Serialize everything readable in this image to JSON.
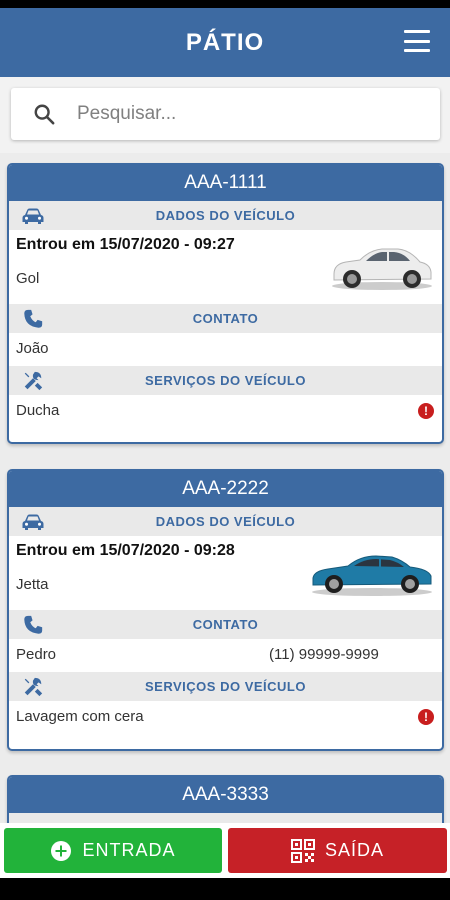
{
  "app": {
    "title": "PÁTIO"
  },
  "search": {
    "placeholder": "Pesquisar..."
  },
  "labels": {
    "vehicle_data": "DADOS DO VEÍCULO",
    "contact": "CONTATO",
    "services": "SERVIÇOS DO VEÍCULO"
  },
  "vehicles": [
    {
      "plate": "AAA-1111",
      "entry": "Entrou em 15/07/2020 - 09:27",
      "model": "Gol",
      "car_color": "#e9e9e9",
      "contact_name": "João",
      "phone": "",
      "service": "Ducha",
      "alert": "!"
    },
    {
      "plate": "AAA-2222",
      "entry": "Entrou em 15/07/2020 - 09:28",
      "model": "Jetta",
      "car_color": "#1f7ba6",
      "contact_name": "Pedro",
      "phone": "(11) 99999-9999",
      "service": "Lavagem com cera",
      "alert": "!"
    },
    {
      "plate": "AAA-3333"
    }
  ],
  "actions": {
    "entry_label": "ENTRADA",
    "exit_label": "SAÍDA"
  },
  "colors": {
    "primary": "#3d6aa2",
    "entry_button": "#22b33a",
    "exit_button": "#c62127",
    "alert": "#c81e1e"
  }
}
